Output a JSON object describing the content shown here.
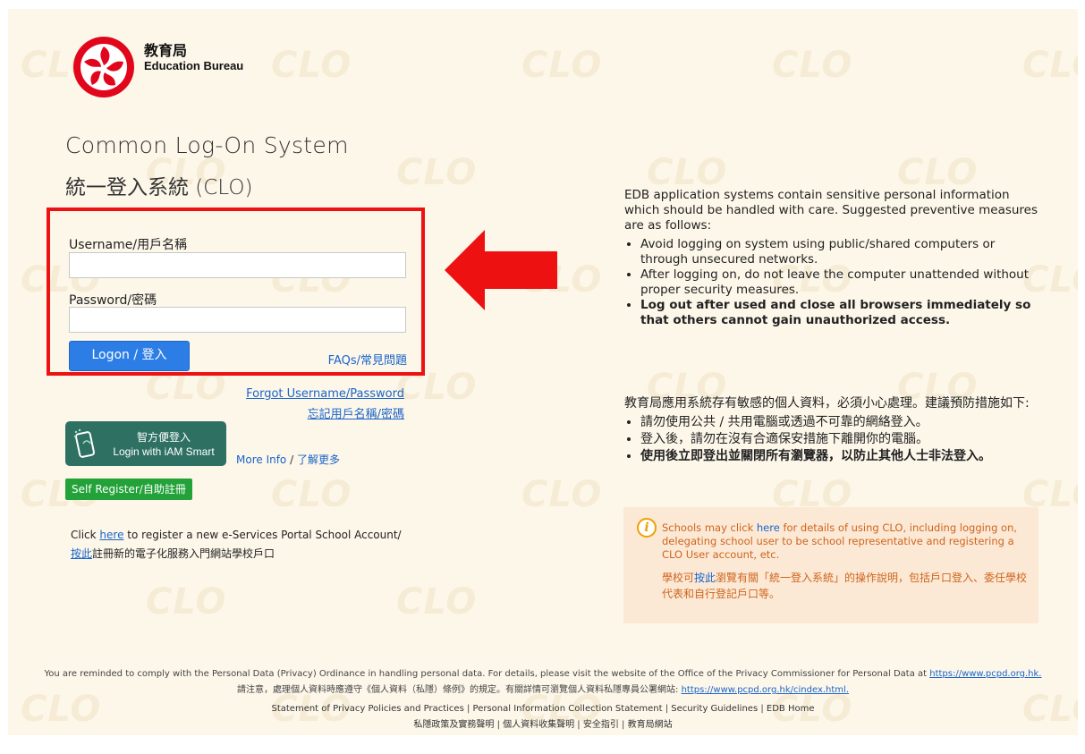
{
  "watermark": "CLO",
  "header": {
    "org_zh": "教育局",
    "org_en": "Education Bureau"
  },
  "title": {
    "en": "Common Log-On System",
    "zh": "統一登入系統 (CLO)"
  },
  "login": {
    "username_label": "Username/用戶名稱",
    "username_value": "",
    "password_label": "Password/密碼",
    "password_value": "",
    "logon_button": "Logon / 登入",
    "faq_link": "FAQs/常見問題"
  },
  "forgot": {
    "en": "Forgot Username/Password",
    "zh": "忘記用戶名稱/密碼"
  },
  "iam_smart": {
    "label_zh": "智方便登入",
    "label_en": "Login with iAM Smart",
    "more_info_en": "More Info",
    "sep": " / ",
    "more_info_zh": "了解更多"
  },
  "self_register": "Self Register/自助註冊",
  "register_notice": {
    "line1_pre": "Click ",
    "line1_link": "here",
    "line1_post": " to register a new e-Services Portal School Account/",
    "line2_link": "按此",
    "line2_post": "註冊新的電子化服務入門網站學校戶口"
  },
  "notice_en": {
    "intro": "EDB application systems contain sensitive personal information which should be handled with care. Suggested preventive measures are as follows:",
    "items": [
      "Avoid logging on system using public/shared computers or through unsecured networks.",
      "After logging on, do not leave the computer unattended without proper security measures.",
      "Log out after used and close all browsers immediately so that others cannot gain unauthorized access."
    ]
  },
  "notice_zh": {
    "intro": "教育局應用系統存有敏感的個人資料，必須小心處理。建議預防措施如下:",
    "items": [
      "請勿使用公共 / 共用電腦或透過不可靠的網絡登入。",
      "登入後，請勿在沒有合適保安措施下離開你的電腦。",
      "使用後立即登出並關閉所有瀏覽器，以防止其他人士非法登入。"
    ]
  },
  "school_info": {
    "en_pre": "Schools may click ",
    "en_link": "here",
    "en_post": " for details of using CLO, including logging on, delegating school user to be school representative and registering a CLO User account, etc.",
    "zh_pre": "學校可",
    "zh_link": "按此",
    "zh_post": "瀏覽有關「統一登入系統」的操作說明，包括戶口登入、委任學校代表和自行登記戶口等。"
  },
  "footer": {
    "privacy_en": "You are reminded to comply with the Personal Data (Privacy) Ordinance in handling personal data. For details, please visit the website of the Office of the Privacy Commissioner for Personal Data at ",
    "privacy_en_link": "https://www.pcpd.org.hk.",
    "privacy_zh": "請注意，處理個人資料時應遵守《個人資料（私隱）條例》的規定。有關詳情可瀏覽個人資料私隱專員公署網站: ",
    "privacy_zh_link": "https://www.pcpd.org.hk/cindex.html.",
    "links_en": [
      "Statement of Privacy Policies and Practices",
      "Personal Information Collection Statement",
      "Security Guidelines",
      "EDB Home"
    ],
    "links_zh": [
      "私隱政策及實務聲明",
      "個人資料收集聲明",
      "安全指引",
      "教育局網站"
    ],
    "sep_wide": " | ",
    "sep_narrow": " | "
  },
  "colors": {
    "page_bg": "#fdf7ea",
    "highlight_border": "#ee1111",
    "primary_button": "#2c7ee6",
    "iam_smart": "#2e7163",
    "self_register": "#22a238",
    "link": "#1a64c9",
    "info_text": "#d0641b",
    "info_bg": "#fbe9d6"
  }
}
